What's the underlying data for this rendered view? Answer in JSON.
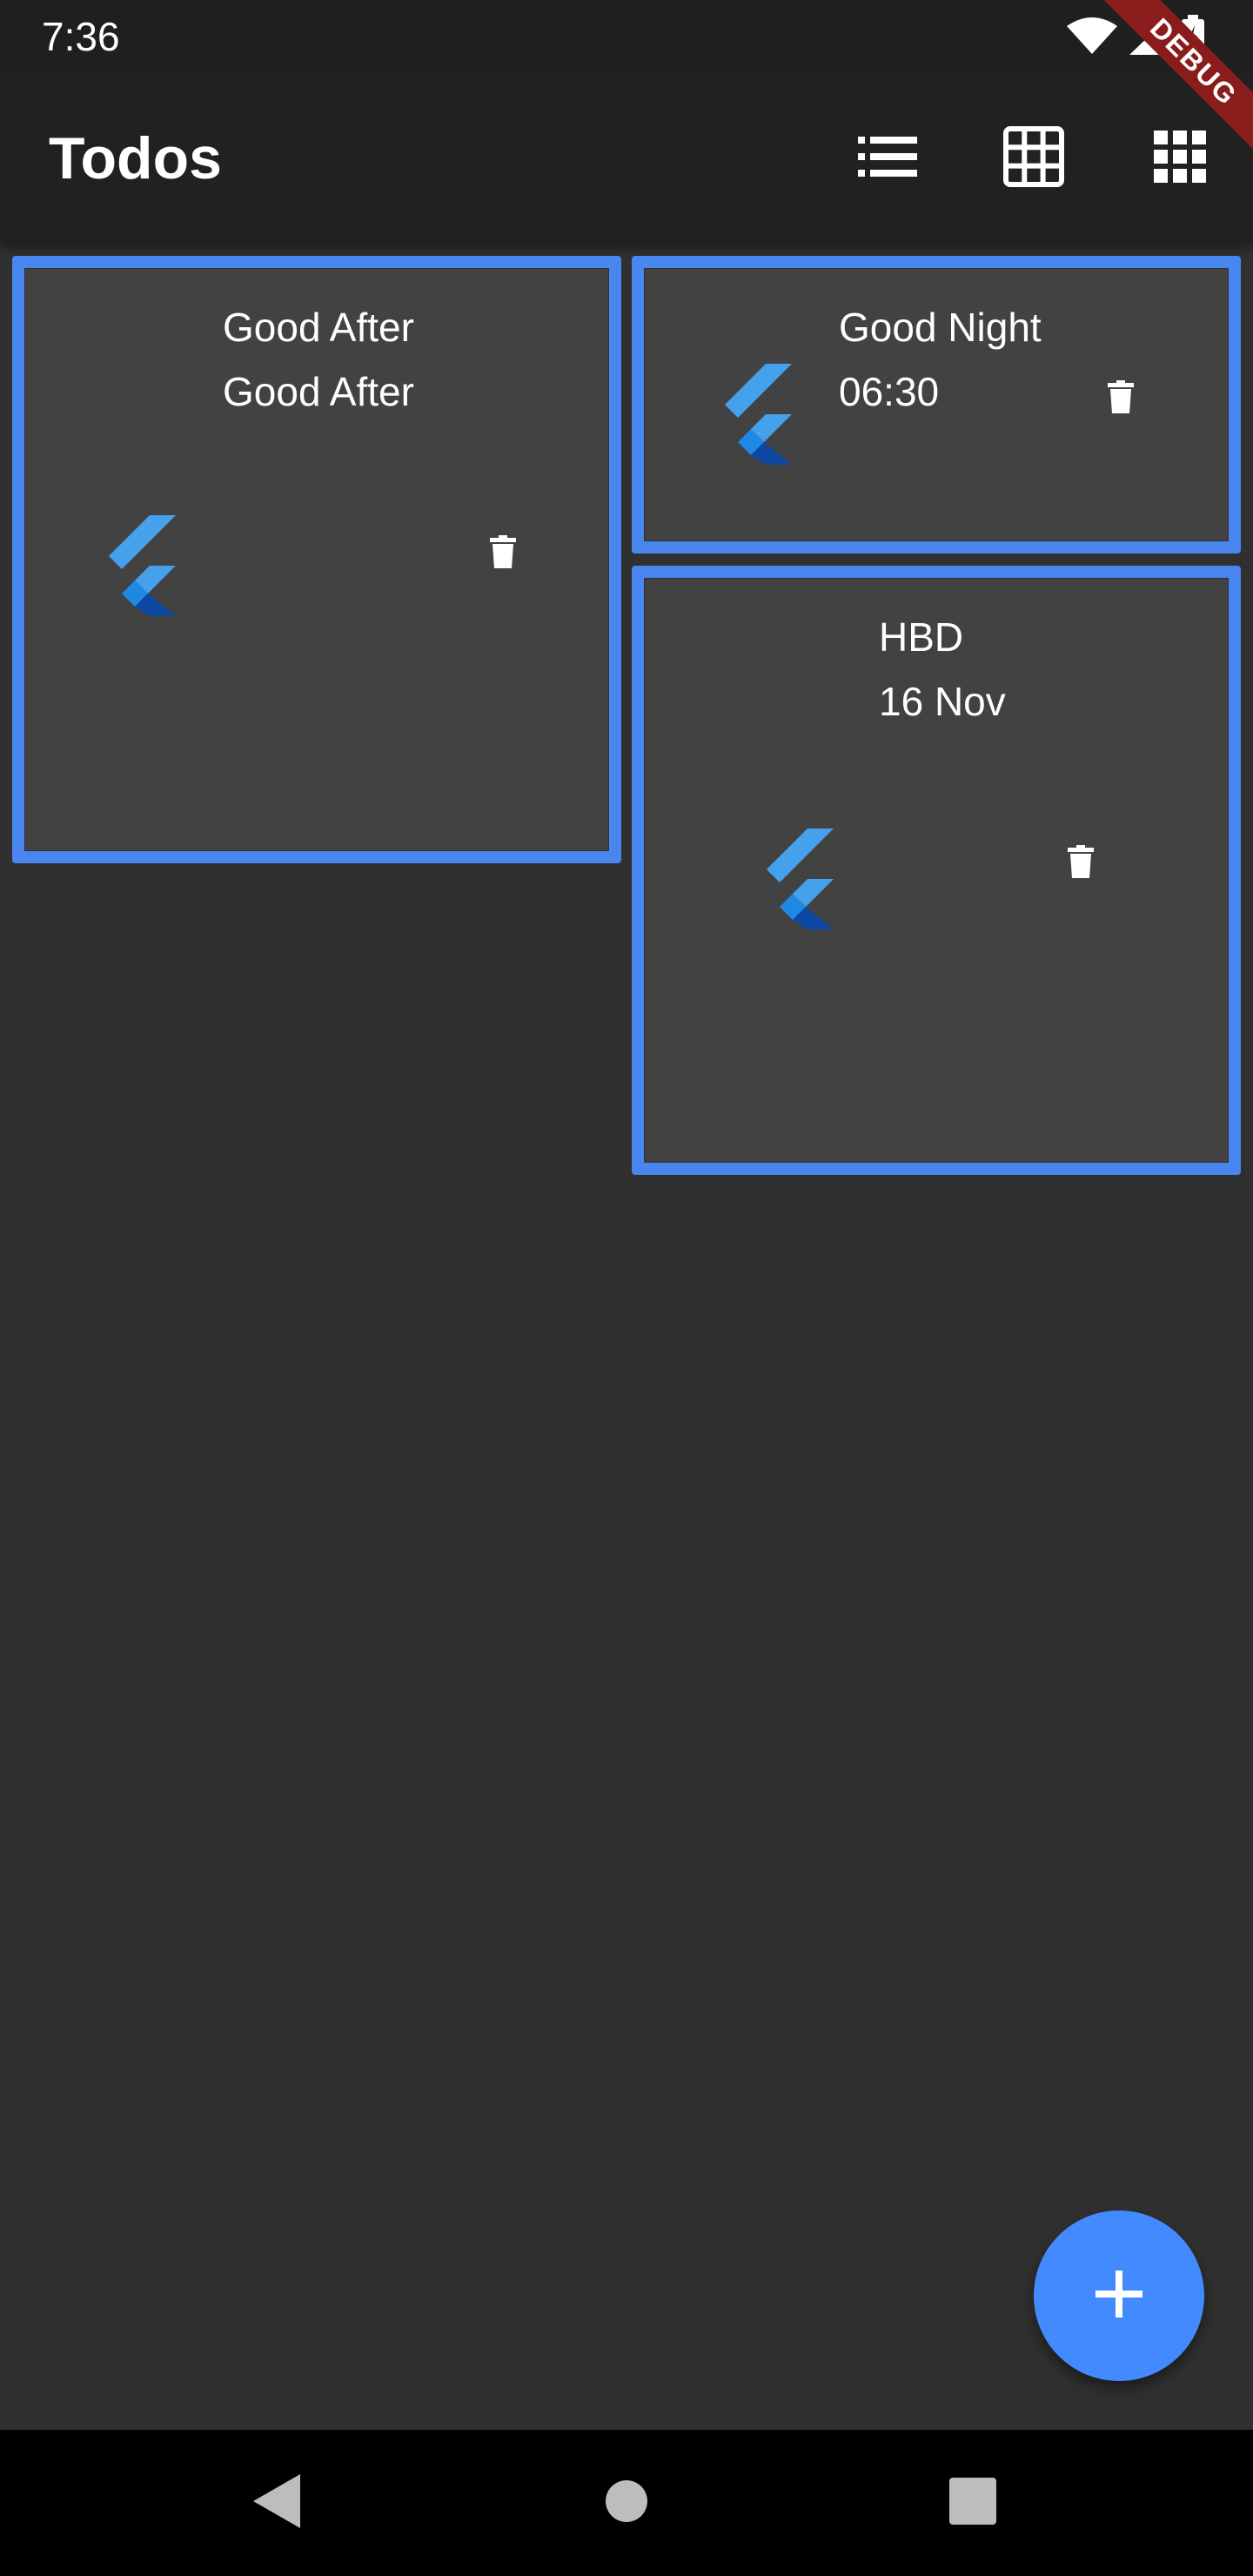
{
  "status_bar": {
    "time": "7:36",
    "icons": [
      "wifi-icon",
      "cell-signal-icon",
      "battery-icon"
    ]
  },
  "debug_banner": {
    "label": "DEBUG",
    "color": "#8a1c1c"
  },
  "app_bar": {
    "title": "Todos",
    "actions": [
      "list-view-icon",
      "grid-view-icon",
      "dense-grid-icon"
    ]
  },
  "todos": [
    {
      "title": "Good After",
      "subtitle": "Good After",
      "icon": "flutter-logo-icon"
    },
    {
      "title": "Good Night",
      "subtitle": "06:30",
      "icon": "flutter-logo-icon"
    },
    {
      "title": "HBD",
      "subtitle": "16 Nov",
      "icon": "flutter-logo-icon"
    }
  ],
  "fab": {
    "icon": "plus-icon",
    "color": "#448aff"
  },
  "nav_bar": {
    "buttons": [
      "back-icon",
      "home-icon",
      "recents-icon"
    ]
  },
  "colors": {
    "background": "#303030",
    "app_bar": "#212121",
    "card": "#424242",
    "card_border": "#4a86f0"
  }
}
